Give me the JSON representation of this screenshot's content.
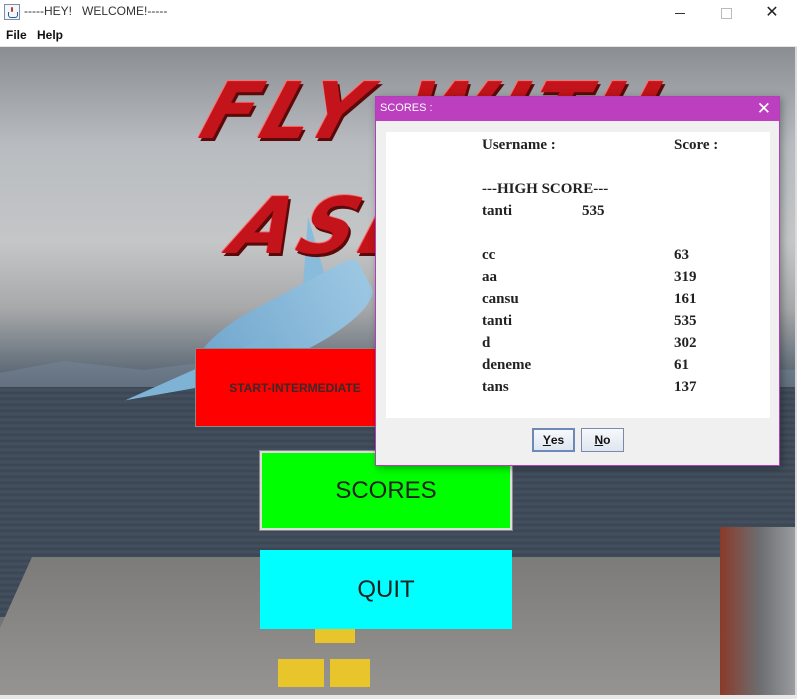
{
  "window": {
    "title": "-----HEY!   WELCOME!-----",
    "close_glyph": "✕"
  },
  "menu": {
    "items": [
      {
        "label": "File"
      },
      {
        "label": "Help"
      }
    ]
  },
  "game": {
    "logo_line1": "FLY WITH",
    "logo_line2": "ASL",
    "buttons": {
      "start": "START-INTERMEDIATE",
      "scores": "SCORES",
      "quit": "QUIT"
    }
  },
  "dialog": {
    "title": "SCORES :",
    "close_glyph": "✕",
    "header": {
      "username": "Username :",
      "score": "Score :"
    },
    "high_score": {
      "label": "---HIGH SCORE---",
      "user": "tanti",
      "score": "535"
    },
    "rows": [
      {
        "user": "cc",
        "score": "63"
      },
      {
        "user": "aa",
        "score": "319"
      },
      {
        "user": "cansu",
        "score": "161"
      },
      {
        "user": "tanti",
        "score": "535"
      },
      {
        "user": "d",
        "score": "302"
      },
      {
        "user": "deneme",
        "score": "61"
      },
      {
        "user": "tans",
        "score": "137"
      }
    ],
    "yes_label": {
      "mnemonic": "Y",
      "rest": "es"
    },
    "no_label": {
      "mnemonic": "N",
      "rest": "o"
    }
  }
}
